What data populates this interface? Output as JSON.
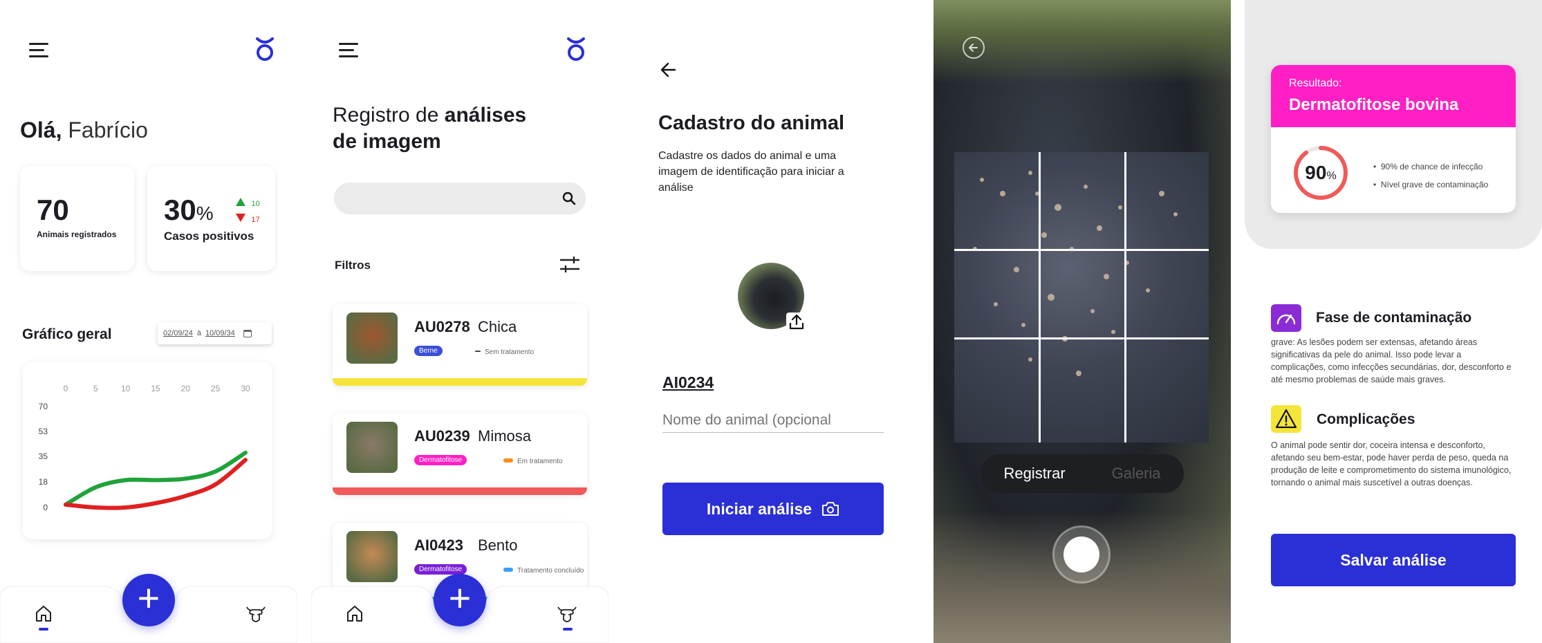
{
  "home": {
    "greeting_bold": "Olá,",
    "greeting_name": "Fabrício",
    "stat1_value": "70",
    "stat1_label": "Animais registrados",
    "stat2_value": "30",
    "stat2_unit": "%",
    "stat2_label": "Casos positivos",
    "trend_up": "10",
    "trend_down": "17",
    "chart_title": "Gráfico geral",
    "date_from": "02/09/24",
    "date_sep": "à",
    "date_to": "10/09/34"
  },
  "chart_data": {
    "type": "line",
    "title": "Gráfico geral",
    "x_ticks": [
      "0",
      "5",
      "10",
      "15",
      "20",
      "25",
      "30"
    ],
    "y_ticks": [
      "70",
      "53",
      "35",
      "18",
      "0"
    ],
    "x": [
      0,
      5,
      10,
      15,
      20,
      25,
      30
    ],
    "series": [
      {
        "color": "#1fa33a",
        "values": [
          2,
          14,
          19,
          19,
          20,
          25,
          38
        ]
      },
      {
        "color": "#e02020",
        "values": [
          2,
          0,
          0,
          3,
          8,
          16,
          33
        ]
      }
    ],
    "xlim": [
      0,
      30
    ],
    "ylim": [
      0,
      70
    ],
    "grid": false
  },
  "records": {
    "title_regular": "Registro de",
    "title_bold_1": "análises",
    "title_bold_2": "de imagem",
    "filters_label": "Filtros",
    "items": [
      {
        "code": "AU0278",
        "name": "Chica",
        "tag": "Berne",
        "tag_color": "#3b4fd8",
        "status": "Sem tratamento",
        "status_color": "#444444",
        "bar_color": "#f5e53a"
      },
      {
        "code": "AU0239",
        "name": "Mimosa",
        "tag": "Dermatofitose",
        "tag_color": "#ff1fc4",
        "status": "Em tratamento",
        "status_color": "#ff8c1a",
        "bar_color": "#f05a5a"
      },
      {
        "code": "AI0423",
        "name": "Bento",
        "tag": "Dermatofitose",
        "tag_color": "#7a1fd6",
        "status": "Tratamento concluído",
        "status_color": "#3aa0ff",
        "bar_color": "#31c46a"
      }
    ]
  },
  "register": {
    "title": "Cadastro do animal",
    "description": "Cadastre os dados do animal e uma imagem de identificação para iniciar a análise",
    "animal_id": "AI0234",
    "name_placeholder": "Nome do animal (opcional",
    "start_button": "Iniciar análise"
  },
  "camera": {
    "mode_active": "Registrar",
    "mode_inactive": "Galeria"
  },
  "result": {
    "result_label": "Resultado:",
    "result_title": "Dermatofitose bovina",
    "percent": "90",
    "percent_unit": "%",
    "percent_value": 0.9,
    "bullet1": "90% de chance de infecção",
    "bullet2": "Nível grave de contaminação",
    "phase_title": "Fase de contaminação",
    "phase_text": "grave: As lesões podem ser extensas, afetando áreas significativas da pele do animal. Isso pode levar a complicações, como infecções secundárias, dor, desconforto e até mesmo problemas de saúde mais graves.",
    "complications_title": "Complicações",
    "complications_text": " O animal pode sentir dor, coceira intensa e desconforto, afetando seu bem-estar, pode haver perda de peso, queda na produção de leite e comprometimento do sistema imunológico, tornando o animal mais suscetível a outras doenças.",
    "save_button": "Salvar análise"
  },
  "colors": {
    "accent": "#2a2fd6",
    "magenta": "#ff1fc4",
    "green": "#1fa33a",
    "red": "#e02020"
  },
  "icons": [
    "menu-icon",
    "taurus-logo-icon",
    "search-icon",
    "filter-icon",
    "back-arrow-icon",
    "upload-icon",
    "camera-icon",
    "home-icon",
    "cow-icon",
    "speedometer-icon",
    "warning-icon",
    "shutter-icon"
  ]
}
